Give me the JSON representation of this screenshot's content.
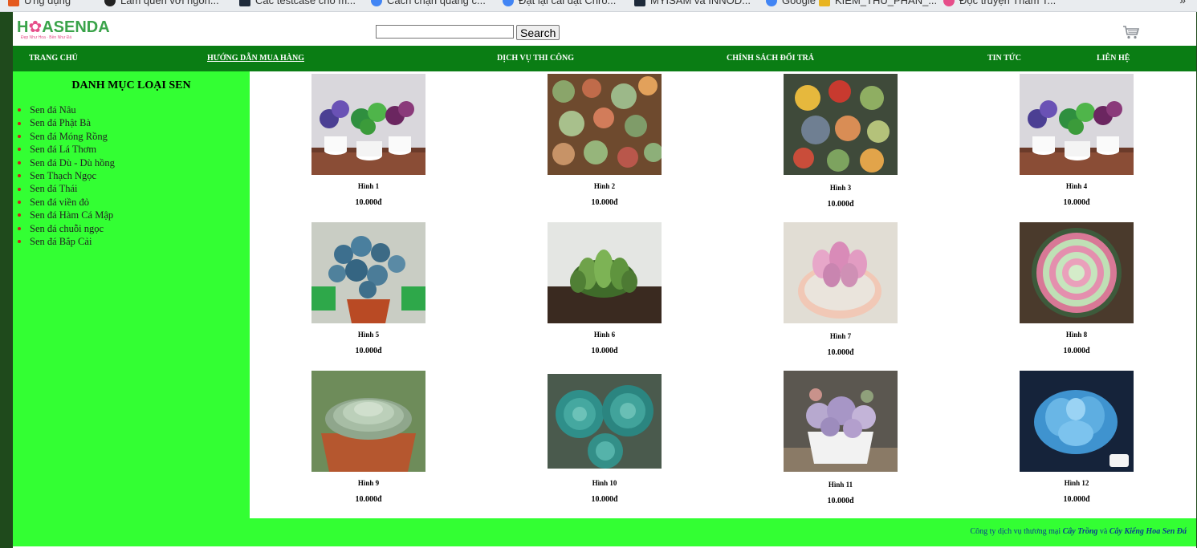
{
  "bookmarks_bar": {
    "items": [
      {
        "label": "Ứng dụng",
        "icon": "apps-grid-icon",
        "color": "#e45a1f"
      },
      {
        "label": "Làm quen với ngôn...",
        "icon": "site-logo-icon",
        "color": "#222222"
      },
      {
        "label": "Các testcase cho m...",
        "icon": "doc-icon",
        "color": "#1e2a3a"
      },
      {
        "label": "Cách chặn quảng c...",
        "icon": "google-icon",
        "color": "#4285f4"
      },
      {
        "label": "Đặt lại cài đặt Chro...",
        "icon": "google-icon",
        "color": "#4285f4"
      },
      {
        "label": "MYISAM và INNOD...",
        "icon": "doc-icon",
        "color": "#1e2a3a"
      },
      {
        "label": "Google",
        "icon": "google-icon",
        "color": "#4285f4"
      },
      {
        "label": "KIEM_THU_PHAN_...",
        "icon": "folder-icon",
        "color": "#e8b421"
      },
      {
        "label": "Đọc truyện Thám T...",
        "icon": "flower-icon",
        "color": "#e64e8a"
      }
    ],
    "more_label": "»"
  },
  "header": {
    "logo_text_before": "H",
    "logo_text_flower": "✿",
    "logo_text_after": "ASENDA",
    "logo_tagline": "Đẹp Như Hoa · Bền Như Đá",
    "search_placeholder": "",
    "search_value": "",
    "search_button": "Search",
    "cart_icon": "shopping-cart-icon"
  },
  "nav": {
    "items": [
      {
        "label": "TRANG CHỦ"
      },
      {
        "label": "HƯỚNG DẪN MUA HÀNG"
      },
      {
        "label": "DỊCH VỤ THI CÔNG"
      },
      {
        "label": "CHÍNH SÁCH ĐỔI TRẢ"
      },
      {
        "label": "TIN TỨC"
      },
      {
        "label": "LIÊN HỆ"
      }
    ]
  },
  "sidebar": {
    "title": "DANH MỤC LOẠI SEN",
    "categories": [
      "Sen đá Nâu",
      "Sen đá Phật Bà",
      "Sen đá Móng Rồng",
      "Sen đá Lá Thơm",
      "Sen đá Dù - Dù hồng",
      "Sen Thạch Ngọc",
      "Sen đá Thái",
      "Sen đá viền đỏ",
      "Sen đá Hàm Cá Mập",
      "Sen đá chuỗi ngọc",
      "Sen đá Bắp Cải"
    ]
  },
  "products": [
    {
      "name": "Hình 1",
      "price": "10.000đ",
      "image": "potted-bonsai-succulents-icon"
    },
    {
      "name": "Hình 2",
      "price": "10.000đ",
      "image": "succulent-garden-icon"
    },
    {
      "name": "Hình 3",
      "price": "10.000đ",
      "image": "succulent-bowl-icon"
    },
    {
      "name": "Hình 4",
      "price": "10.000đ",
      "image": "potted-bonsai-succulents-icon"
    },
    {
      "name": "Hình 5",
      "price": "10.000đ",
      "image": "blue-succulent-cluster-icon"
    },
    {
      "name": "Hình 6",
      "price": "10.000đ",
      "image": "haworthia-icon"
    },
    {
      "name": "Hình 7",
      "price": "10.000đ",
      "image": "pink-succulent-pot-icon"
    },
    {
      "name": "Hình 8",
      "price": "10.000đ",
      "image": "variegated-rosette-icon"
    },
    {
      "name": "Hình 9",
      "price": "10.000đ",
      "image": "echeveria-terracotta-icon"
    },
    {
      "name": "Hình 10",
      "price": "10.000đ",
      "image": "blue-rosettes-icon"
    },
    {
      "name": "Hình 11",
      "price": "10.000đ",
      "image": "lavender-succulents-icon"
    },
    {
      "name": "Hình 12",
      "price": "10.000đ",
      "image": "blue-jelly-succulent-icon"
    }
  ],
  "footer": {
    "text_prefix": "Công ty dịch vụ thương mại ",
    "brand1": "Cây Trồng",
    "text_mid": " và ",
    "brand2": "Cây Kiểng Hoa Sen Đá"
  },
  "colors": {
    "nav_bg": "#0a7d14",
    "sidebar_bg": "#33ff33",
    "logo_green": "#3aa34a",
    "logo_pink": "#e64e8a",
    "footer_link": "#0a3d8f"
  }
}
